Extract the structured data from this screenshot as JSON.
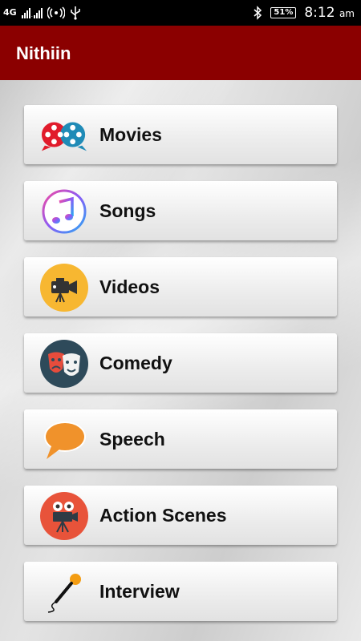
{
  "status_bar": {
    "network": "4G",
    "battery": "51%",
    "time": "8:12",
    "ampm": "am"
  },
  "app_bar": {
    "title": "Nithiin"
  },
  "menu": [
    {
      "label": "Movies",
      "icon": "film-reels-icon"
    },
    {
      "label": "Songs",
      "icon": "music-note-icon"
    },
    {
      "label": "Videos",
      "icon": "video-camera-icon"
    },
    {
      "label": "Comedy",
      "icon": "comedy-masks-icon"
    },
    {
      "label": "Speech",
      "icon": "speech-bubble-icon"
    },
    {
      "label": "Action Scenes",
      "icon": "movie-camera-icon"
    },
    {
      "label": "Interview",
      "icon": "microphone-icon"
    }
  ]
}
